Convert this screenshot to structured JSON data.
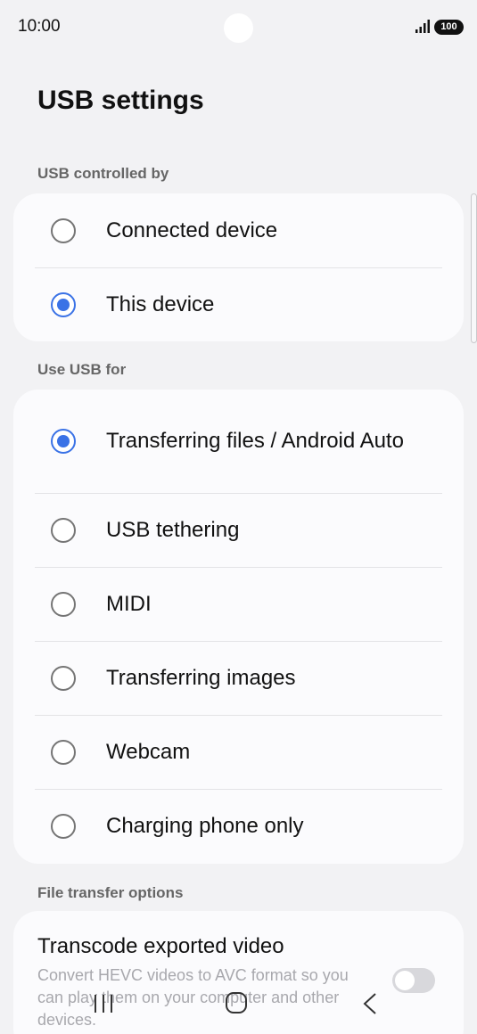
{
  "status_bar": {
    "time": "10:00",
    "battery": "100"
  },
  "page": {
    "title": "USB settings"
  },
  "usb_controlled_by": {
    "header": "USB controlled by",
    "options": [
      {
        "label": "Connected device",
        "selected": false
      },
      {
        "label": "This device",
        "selected": true
      }
    ]
  },
  "use_usb_for": {
    "header": "Use USB for",
    "options": [
      {
        "label": "Transferring files / Android Auto",
        "selected": true
      },
      {
        "label": "USB tethering",
        "selected": false
      },
      {
        "label": "MIDI",
        "selected": false
      },
      {
        "label": "Transferring images",
        "selected": false
      },
      {
        "label": "Webcam",
        "selected": false
      },
      {
        "label": "Charging phone only",
        "selected": false
      }
    ]
  },
  "file_transfer_options": {
    "header": "File transfer options",
    "transcode": {
      "title": "Transcode exported video",
      "description": "Convert HEVC videos to AVC format so you can play them on your computer and other devices.",
      "enabled": false
    }
  },
  "colors": {
    "accent": "#3a72e6",
    "background": "#f2f2f4",
    "card": "#fbfbfd"
  },
  "nav": {
    "recents_icon": "recents-icon",
    "home_icon": "home-icon",
    "back_icon": "back-icon"
  }
}
